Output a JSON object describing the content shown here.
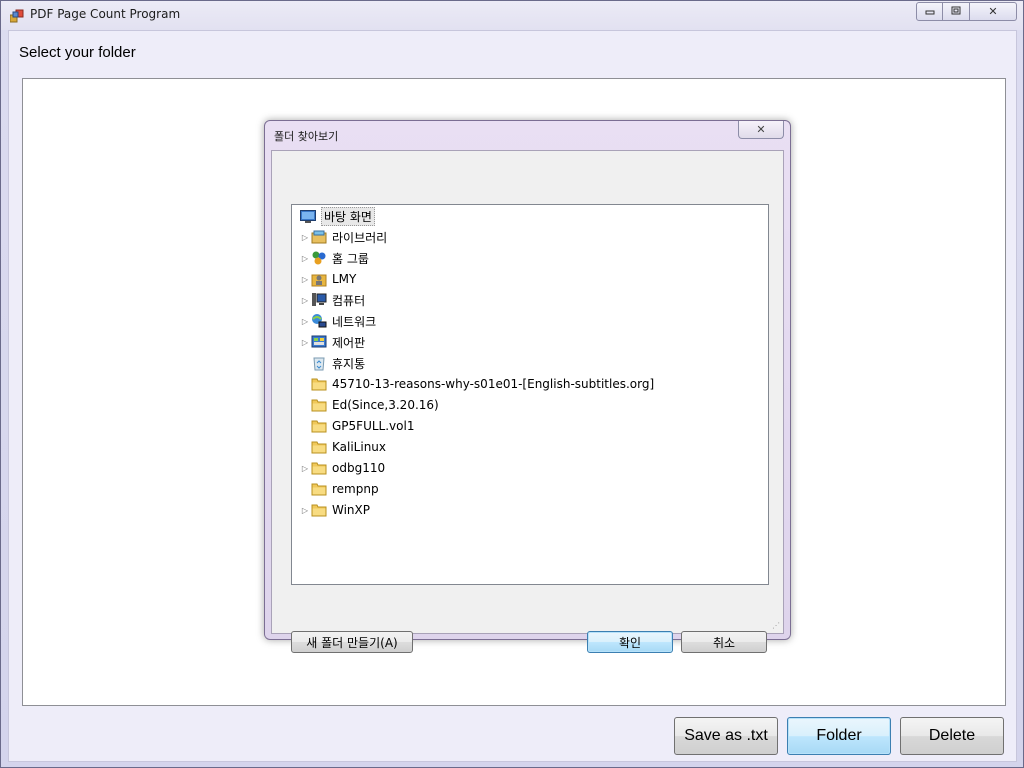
{
  "window": {
    "title": "PDF Page Count Program",
    "minimize_glyph": "▭",
    "maximize_glyph": "□",
    "close_glyph": "✕"
  },
  "main": {
    "prompt_label": "Select your folder",
    "buttons": {
      "save_label": "Save as .txt",
      "folder_label": "Folder",
      "delete_label": "Delete"
    }
  },
  "dialog": {
    "title": "폴더 찾아보기",
    "close_glyph": "✕",
    "tree": [
      {
        "label": "바탕 화면",
        "icon": "desktop-icon",
        "expandable": false,
        "selected": true,
        "level": 0
      },
      {
        "label": "라이브러리",
        "icon": "library-icon",
        "expandable": true,
        "selected": false,
        "level": 1
      },
      {
        "label": "홈 그룹",
        "icon": "homegroup-icon",
        "expandable": true,
        "selected": false,
        "level": 1
      },
      {
        "label": "LMY",
        "icon": "user-folder-icon",
        "expandable": true,
        "selected": false,
        "level": 1
      },
      {
        "label": "컴퓨터",
        "icon": "computer-icon",
        "expandable": true,
        "selected": false,
        "level": 1
      },
      {
        "label": "네트워크",
        "icon": "network-icon",
        "expandable": true,
        "selected": false,
        "level": 1
      },
      {
        "label": "제어판",
        "icon": "control-panel-icon",
        "expandable": true,
        "selected": false,
        "level": 1
      },
      {
        "label": "휴지통",
        "icon": "recycle-bin-icon",
        "expandable": false,
        "selected": false,
        "level": 1
      },
      {
        "label": "45710-13-reasons-why-s01e01-[English-subtitles.org]",
        "icon": "folder-icon",
        "expandable": false,
        "selected": false,
        "level": 1
      },
      {
        "label": "Ed(Since,3.20.16)",
        "icon": "folder-icon",
        "expandable": false,
        "selected": false,
        "level": 1
      },
      {
        "label": "GP5FULL.vol1",
        "icon": "folder-icon",
        "expandable": false,
        "selected": false,
        "level": 1
      },
      {
        "label": "KaliLinux",
        "icon": "folder-icon",
        "expandable": false,
        "selected": false,
        "level": 1
      },
      {
        "label": "odbg110",
        "icon": "folder-icon",
        "expandable": true,
        "selected": false,
        "level": 1
      },
      {
        "label": "rempnp",
        "icon": "folder-icon",
        "expandable": false,
        "selected": false,
        "level": 1
      },
      {
        "label": "WinXP",
        "icon": "folder-icon",
        "expandable": true,
        "selected": false,
        "level": 1
      }
    ],
    "buttons": {
      "new_folder_label": "새 폴더 만들기(A)",
      "ok_label": "확인",
      "cancel_label": "취소"
    }
  },
  "colors": {
    "accent_focus": "#3c7fb1",
    "folder_yellow": "#e8b640"
  }
}
